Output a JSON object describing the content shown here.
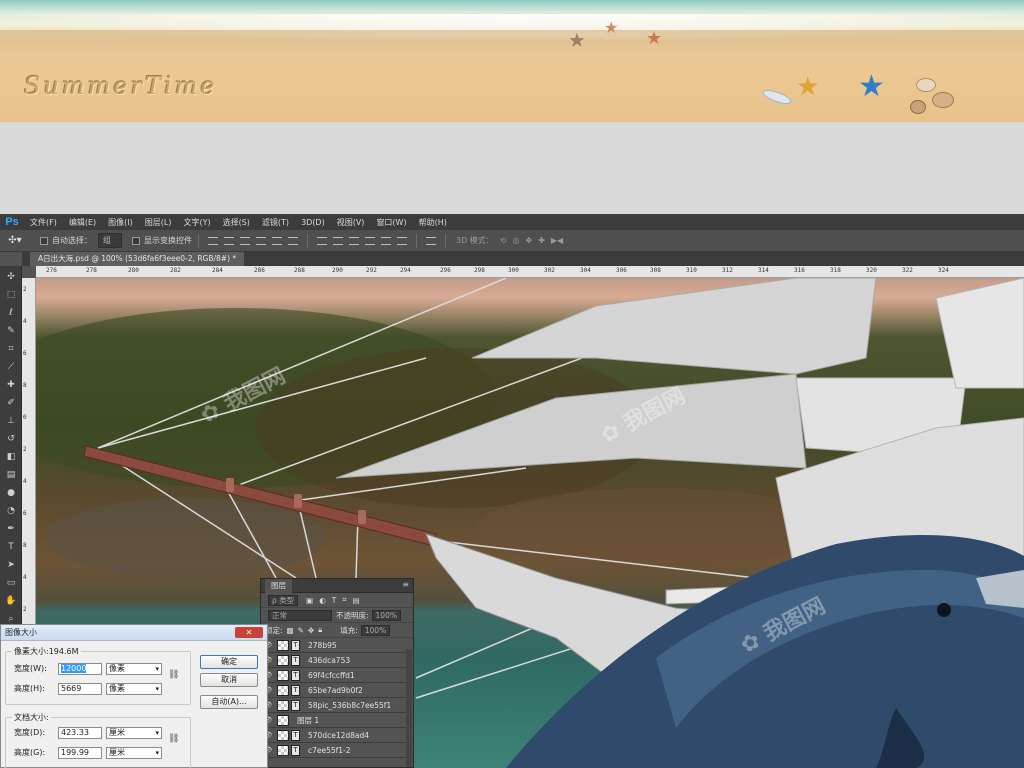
{
  "banner": {
    "title": "SummerTime"
  },
  "photoshop": {
    "logo": "Ps",
    "menu": [
      "文件(F)",
      "编辑(E)",
      "图像(I)",
      "图层(L)",
      "文字(Y)",
      "选择(S)",
      "滤镜(T)",
      "3D(D)",
      "视图(V)",
      "窗口(W)",
      "帮助(H)"
    ],
    "options": {
      "auto_select_label": "自动选择：",
      "auto_select_value": "组",
      "show_transform_label": "显示变换控件",
      "mode_3d_label": "3D 模式："
    },
    "doc_tab": "A日出大海.psd @ 100% (53d6fa6f3eee0-2, RGB/8#) *",
    "ruler_top": [
      "276",
      "278",
      "280",
      "282",
      "284",
      "286",
      "288",
      "290",
      "292",
      "294",
      "296",
      "298",
      "300",
      "302",
      "304",
      "306",
      "308",
      "310",
      "312",
      "314",
      "316",
      "318",
      "320",
      "322",
      "324"
    ],
    "ruler_left": [
      "2",
      "4",
      "6",
      "8",
      "0",
      "2",
      "4",
      "6",
      "8",
      "4",
      "2",
      "2",
      "4",
      "6",
      "8",
      "2"
    ]
  },
  "layers_panel": {
    "tab": "图层",
    "filter_label": "ρ 类型",
    "blend_mode": "正常",
    "opacity_label": "不透明度:",
    "opacity_value": "100%",
    "lock_label": "锁定:",
    "fill_label": "填充:",
    "fill_value": "100%",
    "layers": [
      {
        "name": "278b95",
        "type": "text"
      },
      {
        "name": "436dca753",
        "type": "text"
      },
      {
        "name": "69f4cfccffd1",
        "type": "text"
      },
      {
        "name": "65be7ad9b0f2",
        "type": "text"
      },
      {
        "name": "58pic_536b8c7ee55f1",
        "type": "text"
      },
      {
        "name": "图层 1",
        "type": "pixel"
      },
      {
        "name": "570dce12d8ad4",
        "type": "text"
      },
      {
        "name": "c7ee55f1-2",
        "type": "text"
      }
    ]
  },
  "dialog": {
    "title": "图像大小",
    "close": "✕",
    "pixel_dims_label": "像素大小:194.6M",
    "width_label": "宽度(W):",
    "width_value": "12000",
    "width_unit": "像素",
    "height_label": "高度(H):",
    "height_value": "5669",
    "height_unit": "像素",
    "doc_size_label": "文档大小:",
    "doc_width_label": "宽度(D):",
    "doc_width_value": "423.33",
    "doc_width_unit": "厘米",
    "doc_height_label": "高度(G):",
    "doc_height_value": "199.99",
    "doc_height_unit": "厘米",
    "ok": "确定",
    "cancel": "取消",
    "auto": "自动(A)..."
  }
}
